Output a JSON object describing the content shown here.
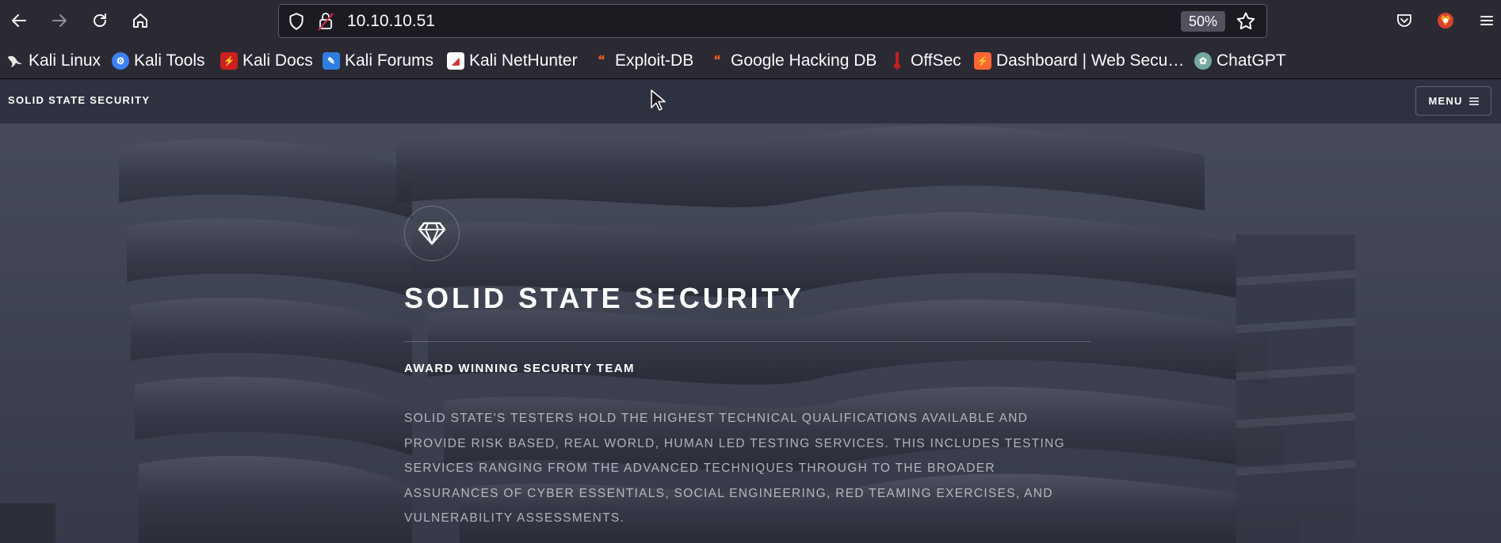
{
  "browser": {
    "url": "10.10.10.51",
    "zoom": "50%",
    "bookmarks": [
      {
        "label": "Kali Linux",
        "icon": "kali-dragon-icon",
        "color": "#1a1a1a"
      },
      {
        "label": "Kali Tools",
        "icon": "kali-tools-icon",
        "color": "#3b82f6"
      },
      {
        "label": "Kali Docs",
        "icon": "kali-docs-icon",
        "color": "#cc1f1f"
      },
      {
        "label": "Kali Forums",
        "icon": "kali-forums-icon",
        "color": "#2f7de1"
      },
      {
        "label": "Kali NetHunter",
        "icon": "kali-nethunter-icon",
        "color": "#d32f2f"
      },
      {
        "label": "Exploit-DB",
        "icon": "exploit-db-icon",
        "color": "#f0621b"
      },
      {
        "label": "Google Hacking DB",
        "icon": "ghdb-icon",
        "color": "#f0621b"
      },
      {
        "label": "OffSec",
        "icon": "offsec-icon",
        "color": "#c81e1e"
      },
      {
        "label": "Dashboard | Web Secu…",
        "icon": "portswigger-icon",
        "color": "#ff6633"
      },
      {
        "label": "ChatGPT",
        "icon": "chatgpt-icon",
        "color": "#74aa9c"
      }
    ]
  },
  "site": {
    "brand": "SOLID STATE SECURITY",
    "menu_label": "MENU",
    "hero": {
      "icon": "diamond-icon",
      "title": "SOLID STATE SECURITY",
      "subtitle": "AWARD WINNING SECURITY TEAM",
      "body": "SOLID STATE'S TESTERS HOLD THE HIGHEST TECHNICAL QUALIFICATIONS AVAILABLE AND PROVIDE RISK BASED, REAL WORLD, HUMAN LED TESTING SERVICES. THIS INCLUDES TESTING SERVICES RANGING FROM THE ADVANCED TECHNIQUES THROUGH TO THE BROADER ASSURANCES OF CYBER ESSENTIALS, SOCIAL ENGINEERING, RED TEAMING EXERCISES, AND VULNERABILITY ASSESSMENTS."
    }
  }
}
